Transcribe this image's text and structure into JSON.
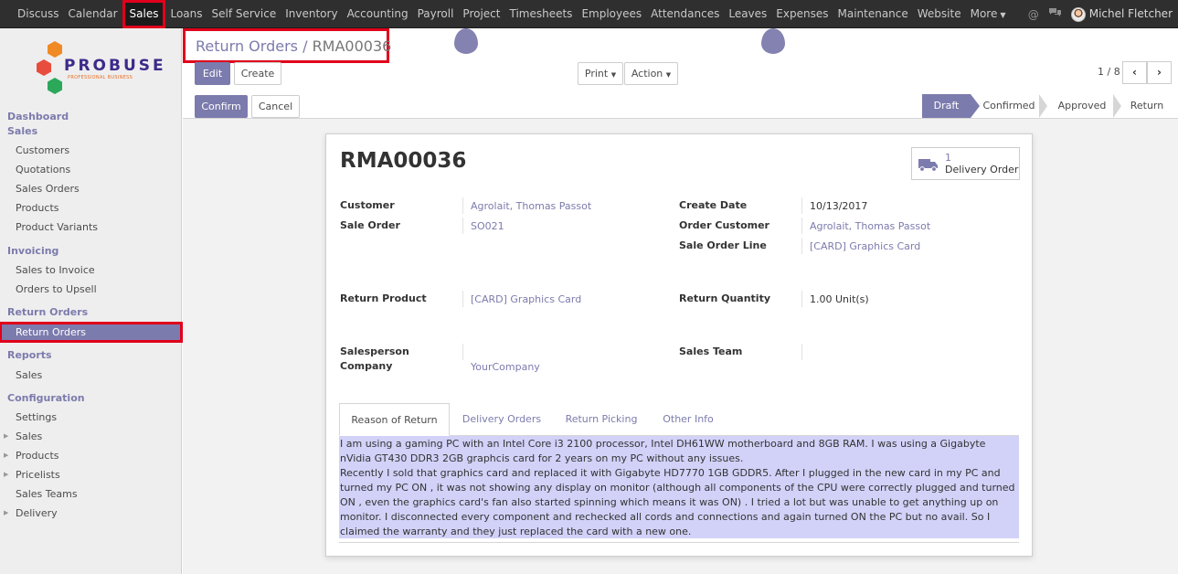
{
  "topmenu": {
    "items": [
      "Discuss",
      "Calendar",
      "Sales",
      "Loans",
      "Self Service",
      "Inventory",
      "Accounting",
      "Payroll",
      "Project",
      "Timesheets",
      "Employees",
      "Attendances",
      "Leaves",
      "Expenses",
      "Maintenance",
      "Website",
      "More"
    ],
    "active": "Sales",
    "user": "Michel Fletcher"
  },
  "logo": {
    "word": "PROBUSE",
    "sub": "PROFESSIONAL BUSINESS"
  },
  "sidebar": {
    "dashboard": "Dashboard",
    "sales_head": "Sales",
    "sales_items": [
      "Customers",
      "Quotations",
      "Sales Orders",
      "Products",
      "Product Variants"
    ],
    "invoicing_head": "Invoicing",
    "invoicing_items": [
      "Sales to Invoice",
      "Orders to Upsell"
    ],
    "return_head": "Return Orders",
    "return_items": [
      "Return Orders"
    ],
    "reports_head": "Reports",
    "reports_items": [
      "Sales"
    ],
    "config_head": "Configuration",
    "config_items": [
      "Settings",
      "Sales",
      "Products",
      "Pricelists",
      "Sales Teams",
      "Delivery"
    ]
  },
  "breadcrumb": {
    "parent": "Return Orders",
    "sep": "/",
    "current": "RMA00036"
  },
  "buttons": {
    "edit": "Edit",
    "create": "Create",
    "print": "Print",
    "action": "Action",
    "confirm": "Confirm",
    "cancel": "Cancel"
  },
  "pager": {
    "value": "1 / 8",
    "prev": "‹",
    "next": "›"
  },
  "stages": [
    "Draft",
    "Confirmed",
    "Approved",
    "Return"
  ],
  "current_stage": "Draft",
  "form": {
    "title": "RMA00036",
    "smart_button": {
      "count": "1",
      "label": "Delivery Order"
    },
    "customer_label": "Customer",
    "customer": "Agrolait, Thomas Passot",
    "sale_order_label": "Sale Order",
    "sale_order": "SO021",
    "create_date_label": "Create Date",
    "create_date": "10/13/2017",
    "order_customer_label": "Order Customer",
    "order_customer": "Agrolait, Thomas Passot",
    "sale_order_line_label": "Sale Order Line",
    "sale_order_line": "[CARD] Graphics Card",
    "return_product_label": "Return Product",
    "return_product": "[CARD] Graphics Card",
    "return_quantity_label": "Return Quantity",
    "return_quantity": "1.00",
    "return_quantity_unit": "Unit(s)",
    "salesperson_label": "Salesperson",
    "company_label": "Company",
    "company": "YourCompany",
    "sales_team_label": "Sales Team"
  },
  "tabs": [
    "Reason of Return",
    "Delivery Orders",
    "Return Picking",
    "Other Info"
  ],
  "reason": {
    "p1": "I am using a gaming PC with an Intel Core  i3 2100 processor, Intel DH61WW motherboard and 8GB RAM. I was using a Gigabyte nVidia GT430 DDR3 2GB graphcis card for 2 years on my PC without any issues.",
    "p2": "Recently I sold that graphics card and replaced it with Gigabyte HD7770 1GB GDDR5. After I plugged in the new card in my PC and turned my PC ON , it was not showing any display on monitor (although all components of the CPU were correctly plugged and turned ON , even the graphics card's fan also started spinning which means it was ON) . I tried a lot but was unable to get anything up on monitor. I disconnected every component and rechecked all cords and connections and again turned ON the PC but no avail. So I claimed the warranty and they just replaced the card with a new one."
  },
  "colors": {
    "accent": "#7c7bad",
    "topbar": "#2f2f2f",
    "highlight": "#e0001b",
    "reason_bg": "#d2d2f9"
  }
}
